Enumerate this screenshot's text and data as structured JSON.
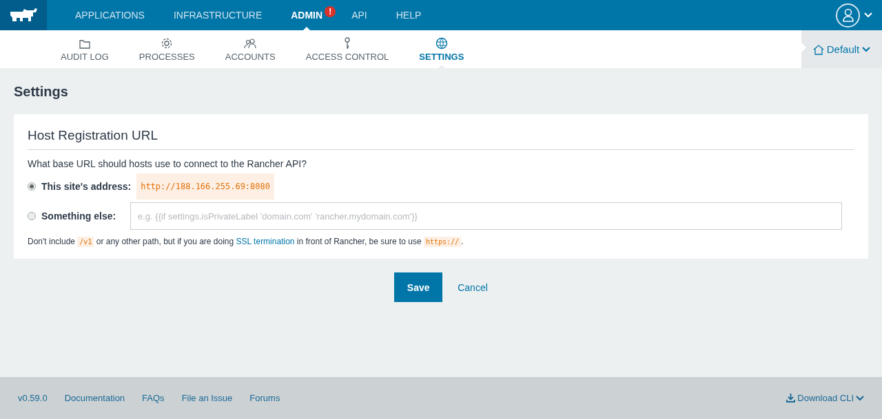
{
  "top_nav": {
    "items": [
      {
        "label": "APPLICATIONS",
        "selected": false
      },
      {
        "label": "INFRASTRUCTURE",
        "selected": false
      },
      {
        "label": "ADMIN",
        "selected": true,
        "alert": "!"
      },
      {
        "label": "API",
        "selected": false
      },
      {
        "label": "HELP",
        "selected": false
      }
    ]
  },
  "sub_nav": {
    "items": [
      {
        "label": "AUDIT LOG",
        "selected": false
      },
      {
        "label": "PROCESSES",
        "selected": false
      },
      {
        "label": "ACCOUNTS",
        "selected": false
      },
      {
        "label": "ACCESS CONTROL",
        "selected": false
      },
      {
        "label": "SETTINGS",
        "selected": true
      }
    ],
    "environment": "Default"
  },
  "page_title": "Settings",
  "card": {
    "title": "Host Registration URL",
    "question": "What base URL should hosts use to connect to the Rancher API?",
    "options": [
      {
        "label": "This site's address:",
        "kind": "value",
        "value": "http://188.166.255.69:8080",
        "selected": true
      },
      {
        "label": "Something else:",
        "kind": "input",
        "placeholder": "e.g. {{if settings.isPrivateLabel 'domain.com' 'rancher.mydomain.com'}}",
        "selected": false
      }
    ],
    "hint": [
      {
        "kind": "text",
        "text": "Don't include "
      },
      {
        "kind": "code",
        "text": "/v1"
      },
      {
        "kind": "text",
        "text": " or any other path, but if you are doing "
      },
      {
        "kind": "link",
        "text": "SSL termination"
      },
      {
        "kind": "text",
        "text": " in front of Rancher, be sure to use "
      },
      {
        "kind": "code",
        "text": "https://"
      },
      {
        "kind": "text",
        "text": "."
      }
    ]
  },
  "buttons": {
    "save": "Save",
    "cancel": "Cancel"
  },
  "footer": {
    "links": [
      "v0.59.0",
      "Documentation",
      "FAQs",
      "File an Issue",
      "Forums"
    ],
    "download": "Download CLI"
  }
}
